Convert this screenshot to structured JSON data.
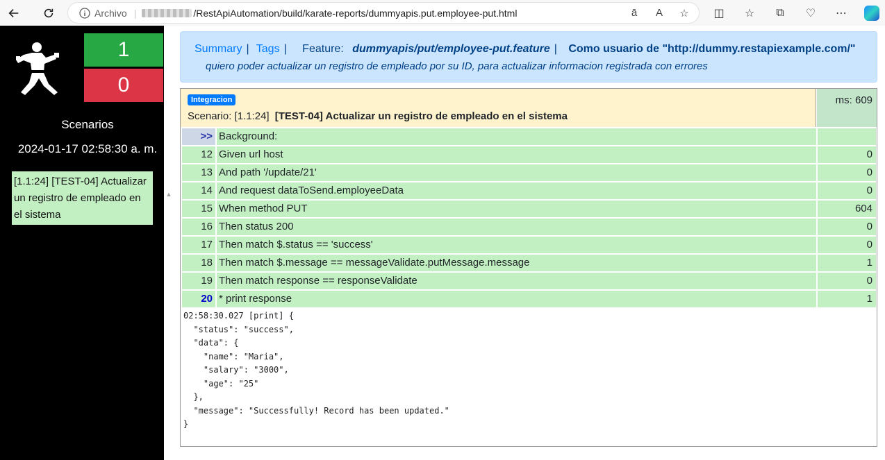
{
  "browser": {
    "archivo_label": "Archivo",
    "url": "/RestApiAutomation/build/karate-reports/dummyapis.put.employee-put.html"
  },
  "sidebar": {
    "passed_count": "1",
    "failed_count": "0",
    "scenarios_label": "Scenarios",
    "date": "2024-01-17 02:58:30 a. m.",
    "items": [
      {
        "label": "[1.1:24] [TEST-04] Actualizar un registro de empleado en el sistema"
      }
    ]
  },
  "feature": {
    "summary_link": "Summary",
    "tags_link": "Tags",
    "feature_label": "Feature:",
    "feature_name": "dummyapis/put/employee-put.feature",
    "feature_desc": "Como usuario de \"http://dummy.restapiexample.com/\"",
    "feature_subdesc": "quiero poder actualizar un registro de empleado por su ID, para actualizar informacion registrada con errores"
  },
  "scenario": {
    "tag": "Integracion",
    "ref": "Scenario: [1.1:24]",
    "title": "[TEST-04] Actualizar un registro de empleado en el sistema",
    "ms": "ms: 609"
  },
  "steps": [
    {
      "line": ">>",
      "text": "Background:",
      "ms": ""
    },
    {
      "line": "12",
      "text": "Given url host",
      "ms": "0"
    },
    {
      "line": "13",
      "text": "And path '/update/21'",
      "ms": "0"
    },
    {
      "line": "14",
      "text": "And request dataToSend.employeeData",
      "ms": "0"
    },
    {
      "line": "15",
      "text": "When method PUT",
      "ms": "604"
    },
    {
      "line": "16",
      "text": "Then status 200",
      "ms": "0"
    },
    {
      "line": "17",
      "text": "Then match $.status == 'success'",
      "ms": "0"
    },
    {
      "line": "18",
      "text": "Then match $.message == messageValidate.putMessage.message",
      "ms": "1"
    },
    {
      "line": "19",
      "text": "Then match response == responseValidate",
      "ms": "0"
    },
    {
      "line": "20",
      "text": "* print response",
      "ms": "1"
    }
  ],
  "log": "02:58:30.027 [print] {\n  \"status\": \"success\",\n  \"data\": {\n    \"name\": \"Maria\",\n    \"salary\": \"3000\",\n    \"age\": \"25\"\n  },\n  \"message\": \"Successfully! Record has been updated.\"\n}"
}
